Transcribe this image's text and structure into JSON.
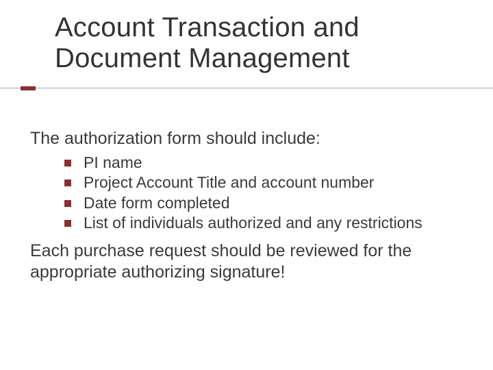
{
  "title": "Account Transaction and Document Management",
  "intro": "The authorization form should include:",
  "bullets": [
    "PI name",
    "Project Account Title and account number",
    "Date form completed",
    "List of individuals authorized and any restrictions"
  ],
  "outro": "Each purchase request should be reviewed for the appropriate authorizing signature!",
  "colors": {
    "accent": "#8b2f2f",
    "rule": "#a9a9a9",
    "text": "#3a3a3a"
  }
}
